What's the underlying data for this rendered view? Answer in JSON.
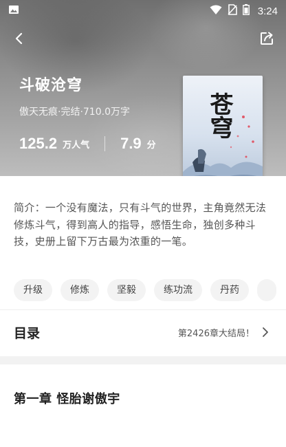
{
  "status_bar": {
    "time": "3:24",
    "icons": [
      "image-icon",
      "wifi-icon",
      "no-sim-icon",
      "battery-icon"
    ]
  },
  "nav": {
    "back_icon": "back-arrow-icon",
    "share_icon": "share-icon"
  },
  "book": {
    "title": "斗破沧穹",
    "meta": "傲天无痕·完结·710.0万字",
    "popularity_value": "125.2",
    "popularity_unit": "万人气",
    "score_value": "7.9",
    "score_unit": "分",
    "cover_title": "苍穹"
  },
  "intro": "简介：一个没有魔法，只有斗气的世界，主角竟然无法修炼斗气，得到高人的指导，感悟生命，独创多种斗技，史册上留下万古最为浓重的一笔。",
  "tags": [
    "升级",
    "修炼",
    "坚毅",
    "练功流",
    "丹药"
  ],
  "catalog": {
    "label": "目录",
    "latest": "第2426章大结局！"
  },
  "first_chapter": "第一章 怪胎谢傲宇",
  "colors": {
    "hero_top": "#6f6f6f",
    "tag_bg": "#f3f3f3",
    "text_primary": "#222222",
    "text_secondary": "#555555"
  }
}
